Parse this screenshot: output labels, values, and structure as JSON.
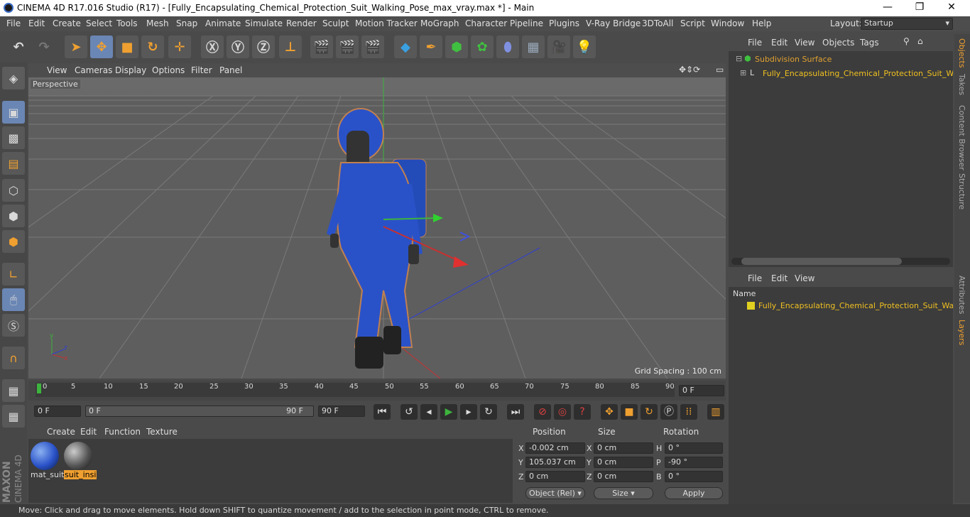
{
  "window": {
    "title": "CINEMA 4D R17.016 Studio (R17) - [Fully_Encapsulating_Chemical_Protection_Suit_Walking_Pose_max_vray.max *] - Main",
    "min": "—",
    "max": "❐",
    "close": "✕"
  },
  "menu": [
    "File",
    "Edit",
    "Create",
    "Select",
    "Tools",
    "Mesh",
    "Snap",
    "Animate",
    "Simulate",
    "Render",
    "Sculpt",
    "Motion Tracker",
    "MoGraph",
    "Character",
    "Pipeline",
    "Plugins",
    "V-Ray Bridge",
    "3DToAll",
    "Script",
    "Window",
    "Help"
  ],
  "layout": {
    "label": "Layout:",
    "value": "Startup"
  },
  "viewport": {
    "menu": [
      "View",
      "Cameras",
      "Display",
      "Options",
      "Filter",
      "Panel"
    ],
    "camera_label": "Perspective",
    "grid_spacing": "Grid Spacing : 100 cm"
  },
  "timeline": {
    "ticks": [
      "0",
      "5",
      "10",
      "15",
      "20",
      "25",
      "30",
      "35",
      "40",
      "45",
      "50",
      "55",
      "60",
      "65",
      "70",
      "75",
      "80",
      "85",
      "90"
    ],
    "current_frame": "0 F"
  },
  "playbar": {
    "start": "0 F",
    "range_start": "0 F",
    "range_end": "90 F",
    "end": "90 F"
  },
  "materials": {
    "menu": [
      "Create",
      "Edit",
      "Function",
      "Texture"
    ],
    "items": [
      "mat_suit",
      "suit_insi"
    ]
  },
  "coords": {
    "headers": [
      "Position",
      "Size",
      "Rotation"
    ],
    "rows": [
      {
        "axis": "X",
        "pos": "-0.002 cm",
        "size_axis": "X",
        "size": "0 cm",
        "rot_axis": "H",
        "rot": "0 °"
      },
      {
        "axis": "Y",
        "pos": "105.037 cm",
        "size_axis": "Y",
        "size": "0 cm",
        "rot_axis": "P",
        "rot": "-90 °"
      },
      {
        "axis": "Z",
        "pos": "0 cm",
        "size_axis": "Z",
        "size": "0 cm",
        "rot_axis": "B",
        "rot": "0 °"
      }
    ],
    "mode": "Object (Rel)",
    "size_mode": "Size",
    "apply": "Apply"
  },
  "objects": {
    "menu": [
      "File",
      "Edit",
      "View",
      "Objects",
      "Tags"
    ],
    "items": [
      "Subdivision Surface",
      "Fully_Encapsulating_Chemical_Protection_Suit_Walk"
    ]
  },
  "layers": {
    "menu": [
      "File",
      "Edit",
      "View"
    ],
    "header": "Name",
    "items": [
      "Fully_Encapsulating_Chemical_Protection_Suit_Walkin"
    ]
  },
  "right_tabs": [
    "Objects",
    "Takes",
    "Content Browser",
    "Structure",
    "Attributes",
    "Layers"
  ],
  "status": "Move: Click and drag to move elements. Hold down SHIFT to quantize movement / add to the selection in point mode, CTRL to remove.",
  "brand": {
    "maxon": "MAXON",
    "c4d": "CINEMA 4D"
  },
  "colors": {
    "accent_orange": "#f0a030",
    "select_blue": "#6a86b4",
    "suit_blue": "#2a52c8"
  }
}
